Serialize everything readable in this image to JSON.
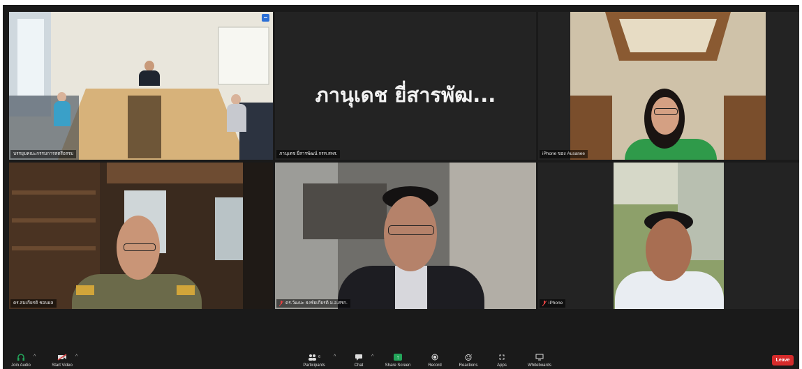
{
  "tiles": [
    {
      "name": "บรรยุมคณะกรรมการสตรีอรรม",
      "muted": false
    },
    {
      "name": "ภานุเดช ยี่สารพัฒน์ กรท.สพร.",
      "display_name": "ภานุเดช ยี่สารพัฒ...",
      "muted": false
    },
    {
      "name": "iPhone ของ Ausanee",
      "muted": false
    },
    {
      "name": "ดร.สมเกียรติ ชอบผล",
      "muted": false
    },
    {
      "name": "ดร.วัฒนะ ธงชัยเกียรติ ม.อ.ศรก.",
      "muted": true
    },
    {
      "name": "iPhone",
      "muted": true
    }
  ],
  "toolbar": {
    "join_audio": "Join Audio",
    "start_video": "Start Video",
    "participants": "Participants",
    "participants_count": "6",
    "chat": "Chat",
    "share_screen": "Share Screen",
    "record": "Record",
    "reactions": "Reactions",
    "apps": "Apps",
    "whiteboards": "Whiteboards",
    "leave": "Leave"
  },
  "colors": {
    "active_speaker": "#c8d93a",
    "share_green": "#23a55a",
    "leave_red": "#d62b2b"
  }
}
